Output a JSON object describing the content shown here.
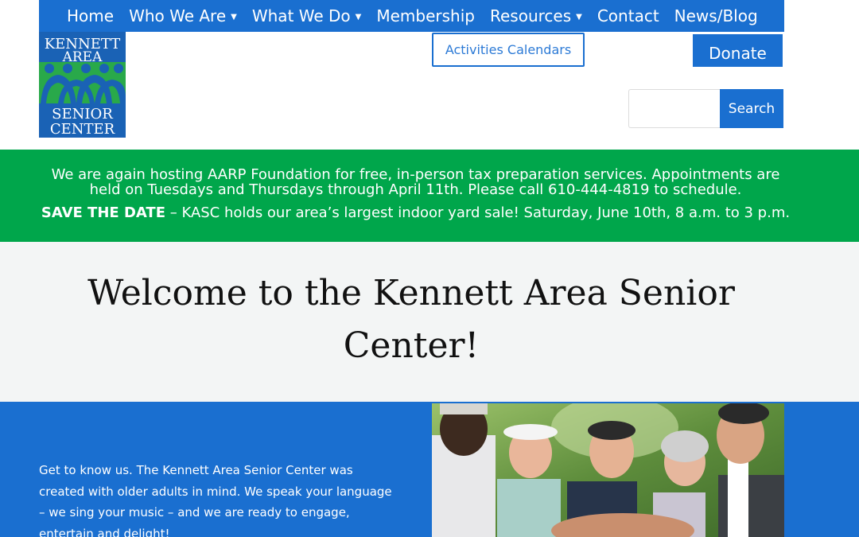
{
  "nav": {
    "items": [
      {
        "label": "Home",
        "has_dropdown": false
      },
      {
        "label": "Who We Are",
        "has_dropdown": true
      },
      {
        "label": "What We Do",
        "has_dropdown": true
      },
      {
        "label": "Membership",
        "has_dropdown": false
      },
      {
        "label": "Resources",
        "has_dropdown": true
      },
      {
        "label": "Contact",
        "has_dropdown": false
      },
      {
        "label": "News/Blog",
        "has_dropdown": false
      }
    ],
    "dropdown_glyph": "⌄"
  },
  "logo": {
    "line1": "KENNETT",
    "line2": "AREA",
    "line3": "SENIOR",
    "line4": "CENTER"
  },
  "header": {
    "activities_label": "Activities Calendars",
    "donate_label": "Donate"
  },
  "search": {
    "value": "",
    "placeholder": "",
    "button_label": "Search"
  },
  "announcement": {
    "line1": "We are again hosting AARP Foundation for free, in-person tax preparation services.  Appointments are held on Tuesdays and Thursdays through April 11th. Please call 610-444-4819 to schedule.",
    "save_the_date_bold": "SAVE THE DATE",
    "save_the_date_text": " – KASC holds our area’s largest indoor yard sale!  Saturday, June 10th, 8 a.m. to 3 p.m."
  },
  "hero": {
    "title": "Welcome to the Kennett Area Senior Center!"
  },
  "about": {
    "text": "Get to know us. The Kennett Area Senior Center was created with older adults in mind. We speak your language – we sing your music – and we are ready to engage, entertain and delight!"
  },
  "colors": {
    "brand_blue": "#1a6fd0",
    "banner_green": "#00a64b",
    "hero_bg": "#f3f5f5"
  }
}
